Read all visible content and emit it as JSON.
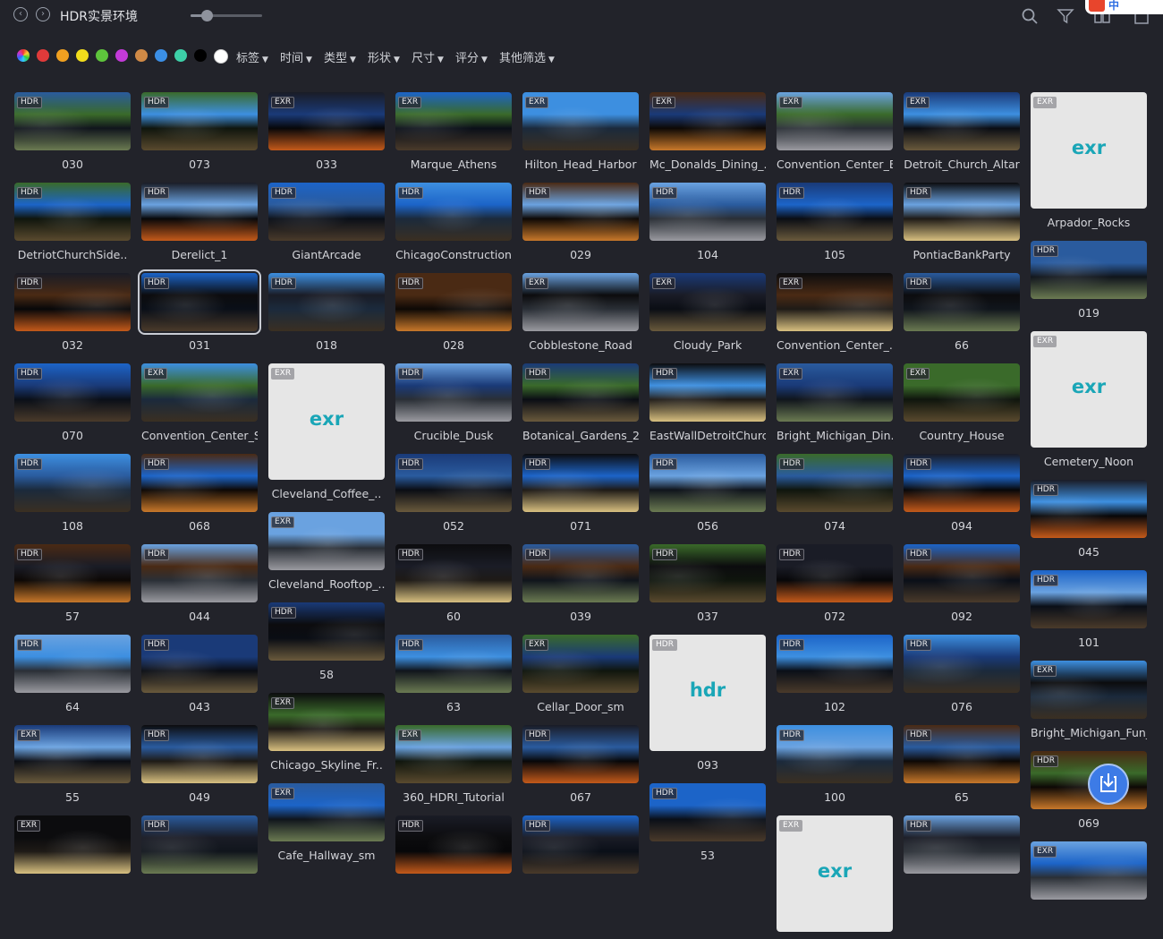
{
  "header": {
    "title": "HDR实景环境",
    "zoom_level": 0.22
  },
  "ime_indicator": {
    "label": "中"
  },
  "filters": {
    "colors": [
      "#e03a3a",
      "#f0a020",
      "#f2dd1c",
      "#5ec43c",
      "#c33ad8",
      "#d08a46",
      "#3b8fe6",
      "#3dd0a8",
      "#000000",
      "#ffffff"
    ],
    "menus": [
      "标签",
      "时间",
      "类型",
      "形状",
      "尺寸",
      "评分",
      "其他筛选"
    ]
  },
  "grid": {
    "columns": [
      [
        {
          "type": "HDR",
          "name": "030"
        },
        {
          "type": "HDR",
          "name": "DetriotChurchSide.."
        },
        {
          "type": "HDR",
          "name": "032"
        },
        {
          "type": "HDR",
          "name": "070"
        },
        {
          "type": "HDR",
          "name": "108"
        },
        {
          "type": "HDR",
          "name": "57"
        },
        {
          "type": "HDR",
          "name": "64"
        },
        {
          "type": "EXR",
          "name": "55"
        },
        {
          "type": "EXR",
          "name": ""
        }
      ],
      [
        {
          "type": "HDR",
          "name": "073"
        },
        {
          "type": "HDR",
          "name": "Derelict_1"
        },
        {
          "type": "HDR",
          "name": "031"
        },
        {
          "type": "EXR",
          "name": "Convention_Center_S.."
        },
        {
          "type": "HDR",
          "name": "068"
        },
        {
          "type": "HDR",
          "name": "044"
        },
        {
          "type": "HDR",
          "name": "043"
        },
        {
          "type": "HDR",
          "name": "049"
        },
        {
          "type": "HDR",
          "name": ""
        }
      ],
      [
        {
          "type": "EXR",
          "name": "033"
        },
        {
          "type": "HDR",
          "name": "GiantArcade"
        },
        {
          "type": "HDR",
          "name": "018"
        },
        {
          "type": "EXR",
          "name": "Cleveland_Coffee_..",
          "placeholder": "exr"
        },
        {
          "type": "EXR",
          "name": "Cleveland_Rooftop_.."
        },
        {
          "type": "HDR",
          "name": "58"
        },
        {
          "type": "EXR",
          "name": "Chicago_Skyline_Fr.."
        },
        {
          "type": "EXR",
          "name": "Cafe_Hallway_sm"
        }
      ],
      [
        {
          "type": "EXR",
          "name": "Marque_Athens"
        },
        {
          "type": "HDR",
          "name": "ChicagoConstruction"
        },
        {
          "type": "HDR",
          "name": "028"
        },
        {
          "type": "HDR",
          "name": "Crucible_Dusk"
        },
        {
          "type": "HDR",
          "name": "052"
        },
        {
          "type": "HDR",
          "name": "60"
        },
        {
          "type": "HDR",
          "name": "63"
        },
        {
          "type": "EXR",
          "name": "360_HDRI_Tutorial"
        },
        {
          "type": "HDR",
          "name": ""
        }
      ],
      [
        {
          "type": "EXR",
          "name": "Hilton_Head_Harbor"
        },
        {
          "type": "HDR",
          "name": "029"
        },
        {
          "type": "EXR",
          "name": "Cobblestone_Road"
        },
        {
          "type": "HDR",
          "name": "Botanical_Gardens_2"
        },
        {
          "type": "HDR",
          "name": "071"
        },
        {
          "type": "HDR",
          "name": "039"
        },
        {
          "type": "EXR",
          "name": "Cellar_Door_sm"
        },
        {
          "type": "HDR",
          "name": "067"
        },
        {
          "type": "HDR",
          "name": ""
        }
      ],
      [
        {
          "type": "EXR",
          "name": "Mc_Donalds_Dining_.."
        },
        {
          "type": "HDR",
          "name": "104"
        },
        {
          "type": "EXR",
          "name": "Cloudy_Park"
        },
        {
          "type": "HDR",
          "name": "EastWallDetroitChurch"
        },
        {
          "type": "HDR",
          "name": "056"
        },
        {
          "type": "HDR",
          "name": "037"
        },
        {
          "type": "HDR",
          "name": "093",
          "placeholder": "hdr"
        },
        {
          "type": "HDR",
          "name": "53"
        }
      ],
      [
        {
          "type": "EXR",
          "name": "Convention_Center_B.."
        },
        {
          "type": "HDR",
          "name": "105"
        },
        {
          "type": "EXR",
          "name": "Convention_Center_.."
        },
        {
          "type": "EXR",
          "name": "Bright_Michigan_Din.."
        },
        {
          "type": "HDR",
          "name": "074"
        },
        {
          "type": "HDR",
          "name": "072"
        },
        {
          "type": "HDR",
          "name": "102"
        },
        {
          "type": "HDR",
          "name": "100"
        },
        {
          "type": "EXR",
          "name": "",
          "placeholder": "exr"
        }
      ],
      [
        {
          "type": "EXR",
          "name": "Detroit_Church_Altar"
        },
        {
          "type": "HDR",
          "name": "PontiacBankParty"
        },
        {
          "type": "HDR",
          "name": "66"
        },
        {
          "type": "EXR",
          "name": "Country_House"
        },
        {
          "type": "HDR",
          "name": "094"
        },
        {
          "type": "HDR",
          "name": "092"
        },
        {
          "type": "HDR",
          "name": "076"
        },
        {
          "type": "HDR",
          "name": "65"
        },
        {
          "type": "HDR",
          "name": ""
        }
      ],
      [
        {
          "type": "EXR",
          "name": "Arpador_Rocks",
          "placeholder": "exr"
        },
        {
          "type": "HDR",
          "name": "019"
        },
        {
          "type": "EXR",
          "name": "Cemetery_Noon",
          "placeholder": "exr"
        },
        {
          "type": "HDR",
          "name": "045"
        },
        {
          "type": "HDR",
          "name": "101"
        },
        {
          "type": "EXR",
          "name": "Bright_Michigan_Fun_.."
        },
        {
          "type": "HDR",
          "name": "069"
        },
        {
          "type": "EXR",
          "name": ""
        }
      ]
    ]
  },
  "icons": {
    "back": "chevron-left-icon",
    "forward": "chevron-right-icon",
    "search": "search-icon",
    "filter": "filter-icon",
    "layout": "layout-icon",
    "shirt": "shirt-icon",
    "import": "import-icon"
  }
}
